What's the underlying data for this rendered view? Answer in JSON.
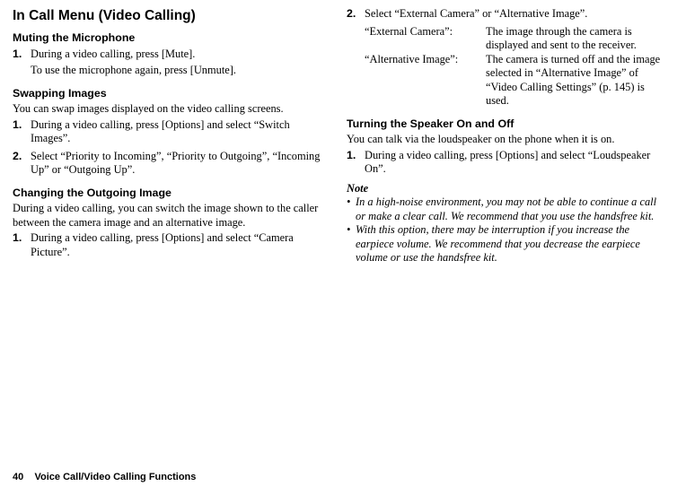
{
  "left": {
    "title": "In Call Menu (Video Calling)",
    "muting": {
      "heading": "Muting the Microphone",
      "steps": [
        {
          "num": "1.",
          "lines": [
            "During a video calling, press [Mute].",
            "To use the microphone again, press [Unmute]."
          ]
        }
      ]
    },
    "swapping": {
      "heading": "Swapping Images",
      "intro": "You can swap images displayed on the video calling screens.",
      "steps": [
        {
          "num": "1.",
          "lines": [
            "During a video calling, press [Options] and select “Switch Images”."
          ]
        },
        {
          "num": "2.",
          "lines": [
            "Select “Priority to Incoming”, “Priority to Outgoing”, “Incoming Up” or “Outgoing Up”."
          ]
        }
      ]
    },
    "changing": {
      "heading": "Changing the Outgoing Image",
      "intro": "During a video calling, you can switch the image shown to the caller between the camera image and an alternative image.",
      "steps": [
        {
          "num": "1.",
          "lines": [
            "During a video calling, press [Options] and select “Camera Picture”."
          ]
        }
      ]
    }
  },
  "right": {
    "step2": {
      "num": "2.",
      "line": "Select “External Camera” or “Alternative Image”."
    },
    "defs": [
      {
        "term": "“External Camera”:",
        "desc": "The image through the camera is displayed and sent to the receiver."
      },
      {
        "term": "“Alternative Image”:",
        "desc": "The camera is turned off and the image selected in “Alternative Image” of “Video Calling Settings” (p. 145) is used."
      }
    ],
    "speaker": {
      "heading": "Turning the Speaker On and Off",
      "intro": "You can talk via the loudspeaker on the phone when it is on.",
      "steps": [
        {
          "num": "1.",
          "lines": [
            "During a video calling, press [Options] and select “Loudspeaker On”."
          ]
        }
      ]
    },
    "noteHead": "Note",
    "notes": [
      "In a high-noise environment, you may not be able to continue a call or make a clear call. We recommend that you use the handsfree kit.",
      "With this option, there may be interruption if you increase the earpiece volume. We recommend that you decrease the earpiece volume or use the handsfree kit."
    ]
  },
  "footer": {
    "page": "40",
    "section": "Voice Call/Video Calling Functions",
    "gap": "    "
  }
}
